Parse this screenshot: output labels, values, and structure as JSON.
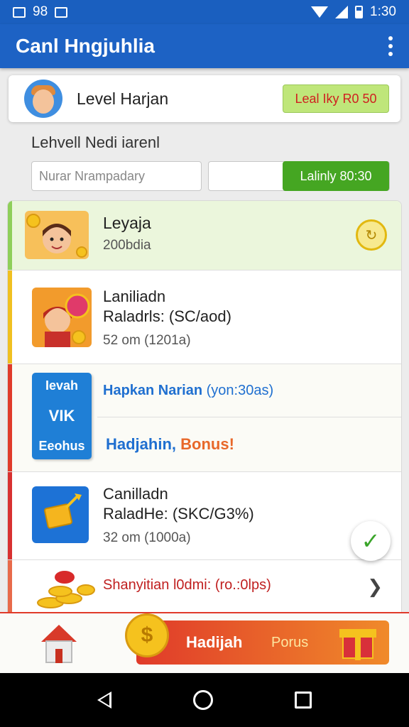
{
  "status_bar": {
    "left_text": "98",
    "time": "1:30"
  },
  "app_bar": {
    "title": "Canl Hngjuhlia"
  },
  "level_card": {
    "name": "Level Harjan",
    "button": "Leal Iky R0 50"
  },
  "section": {
    "title": "Lehvell Nedi iarenl"
  },
  "search": {
    "placeholder": "Nurar Nrampadary",
    "button": "Lalinly 80:30"
  },
  "list": [
    {
      "title": "Leyaja",
      "subtitle": "200bdia"
    },
    {
      "title": "Laniliadn",
      "detail": "Raladrls: (SC/aod)",
      "meta": "52 om (1201a)"
    },
    {
      "line1_bold": "Hapkan Narian",
      "line1_light": "(yon:30as)",
      "line2_main": "Hadjahin,",
      "line2_accent": "Bonus!"
    },
    {
      "title": "Canilladn",
      "detail": "RaladHe: (SKC/G3%)",
      "meta": "32 om (1000a)"
    },
    {
      "title": "Shanyitian l0dmi: (ro.:0lps)"
    }
  ],
  "bonus_card": {
    "top": "Ievah",
    "mid": "VIK",
    "bottom": "Eeohus"
  },
  "bottom_banner": {
    "label": "Hadijah",
    "sub": "Porus"
  },
  "icons": [
    "menu-icon",
    "refresh-icon",
    "check-icon",
    "chevron-right-icon",
    "home-icon",
    "gift-icon",
    "coin-icon",
    "back-icon",
    "home-nav-icon",
    "recents-icon"
  ],
  "colors": {
    "app_bar": "#1d62c4",
    "green_button": "#45a622",
    "accent_red": "#e03a2a",
    "accent_orange": "#f08a2a"
  }
}
